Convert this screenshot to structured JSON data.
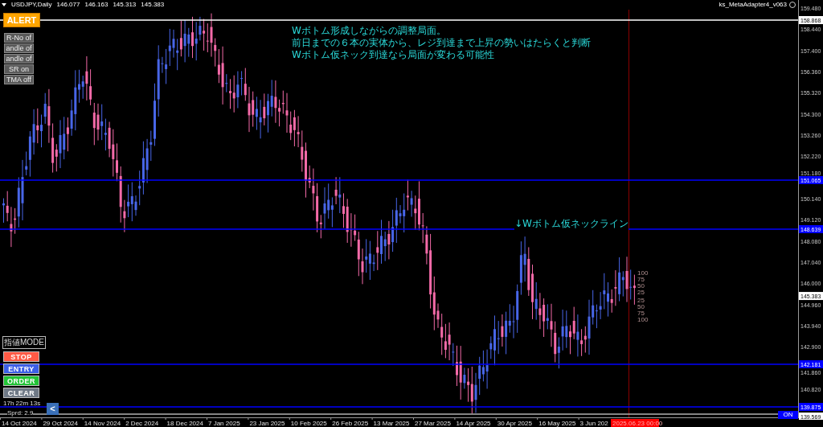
{
  "header": {
    "symbol": "USDJPY,Daily",
    "ohlc": [
      "146.077",
      "146.163",
      "145.313",
      "145.383"
    ],
    "expert_name": "ks_MetaAdapter4_v063"
  },
  "alert_button": "ALERT",
  "toggle_buttons": [
    "R-No of",
    "andle of",
    "andle of",
    "SR on",
    "TMA off"
  ],
  "annotation_lines": [
    "Wボトム形成しながらの調整局面。",
    "前日までの６本の実体から、レジ到達まで上昇の勢いはたらくと判断",
    "Wボトム仮ネック到達なら局面が変わる可能性"
  ],
  "neckline_label": "↓Wボトム仮ネックライン",
  "fib_labels": [
    "100",
    "75",
    "50",
    "25",
    "25",
    "50",
    "75",
    "100"
  ],
  "mode_button": "指値MODE",
  "order_buttons": [
    {
      "label": "STOP",
      "color": "#ff5a45"
    },
    {
      "label": "ENTRY",
      "color": "#3c5fe6"
    },
    {
      "label": "ORDER",
      "color": "#22c437"
    },
    {
      "label": "CLEAR",
      "color": "#6f7986"
    }
  ],
  "timer": "17h 22m 13s",
  "spread": "Sprd: 2.9",
  "collapse_button": "<",
  "price_ticks": [
    "159.480",
    "158.440",
    "157.400",
    "156.360",
    "155.320",
    "154.300",
    "153.260",
    "152.220",
    "151.180",
    "150.140",
    "149.120",
    "148.080",
    "147.040",
    "146.000",
    "144.960",
    "143.940",
    "142.900",
    "141.860",
    "140.820"
  ],
  "levels": [
    {
      "label": "158.868",
      "color": "#ffffff"
    },
    {
      "label": "151.065",
      "color": "#0000ff"
    },
    {
      "label": "148.639",
      "color": "#0000ff"
    },
    {
      "label": "142.181",
      "color": "#0000ff"
    },
    {
      "label": "139.875",
      "color": "#0000ff"
    }
  ],
  "current_price": "145.383",
  "bottom_label": "139.569",
  "on_button": "ON",
  "date_ticks": [
    "14 Oct 2024",
    "29 Oct 2024",
    "14 Nov 2024",
    "2 Dec 2024",
    "18 Dec 2024",
    "7 Jan 2025",
    "23 Jan 2025",
    "10 Feb 2025",
    "26 Feb 2025",
    "13 Mar 2025",
    "27 Mar 2025",
    "14 Apr 2025",
    "30 Apr 2025",
    "16 May 2025",
    "3 Jun 202"
  ],
  "cursor_date": "2025.06.23 00:00"
}
